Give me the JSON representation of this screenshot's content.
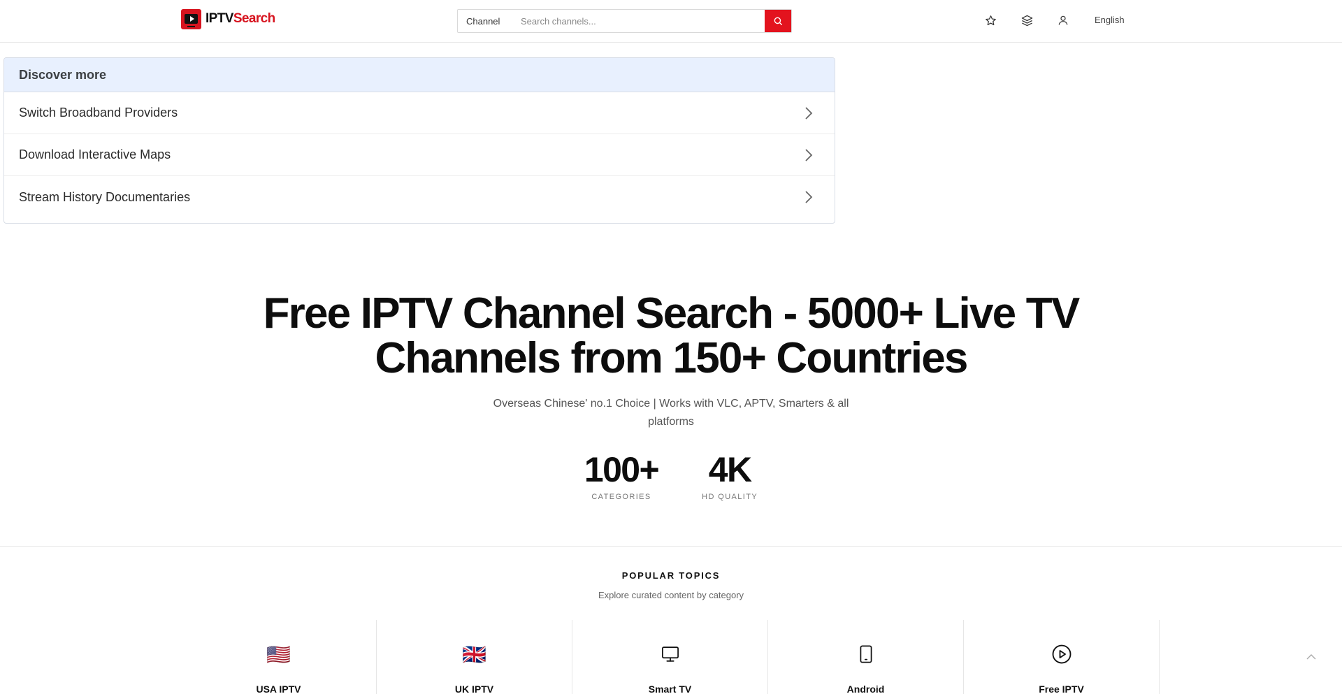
{
  "header": {
    "logo_text_a": "IPTV",
    "logo_text_b": "Search",
    "search_type": "Channel",
    "search_placeholder": "Search channels...",
    "icons": [
      "search-icon",
      "star-icon",
      "layers-icon",
      "user-icon"
    ],
    "language": "English"
  },
  "discover": {
    "title": "Discover more",
    "items": [
      {
        "label": "Switch Broadband Providers"
      },
      {
        "label": "Download Interactive Maps"
      },
      {
        "label": "Stream History Documentaries"
      }
    ]
  },
  "hero": {
    "title_line1": "Free IPTV Channel Search - 5000+ Live TV",
    "title_line2": "Channels from 150+ Countries",
    "subtitle_line1": "Overseas Chinese' no.1 Choice | Works with VLC, APTV, Smarters & all",
    "subtitle_line2": "platforms",
    "stats": [
      {
        "value": "100+",
        "label": "CATEGORIES"
      },
      {
        "value": "4K",
        "label": "HD QUALITY"
      }
    ]
  },
  "popular": {
    "title": "POPULAR TOPICS",
    "subtitle": "Explore curated content by category",
    "cards": [
      {
        "icon": "us-flag-icon",
        "glyph": "🇺🇸",
        "label": "USA IPTV"
      },
      {
        "icon": "uk-flag-icon",
        "glyph": "🇬🇧",
        "label": "UK IPTV"
      },
      {
        "icon": "monitor-icon",
        "label": "Smart TV"
      },
      {
        "icon": "tablet-icon",
        "label": "Android"
      },
      {
        "icon": "play-circle-icon",
        "label": "Free IPTV"
      }
    ]
  },
  "colors": {
    "brand_red": "#e3131e",
    "discover_header_bg": "#e8f0fe"
  }
}
